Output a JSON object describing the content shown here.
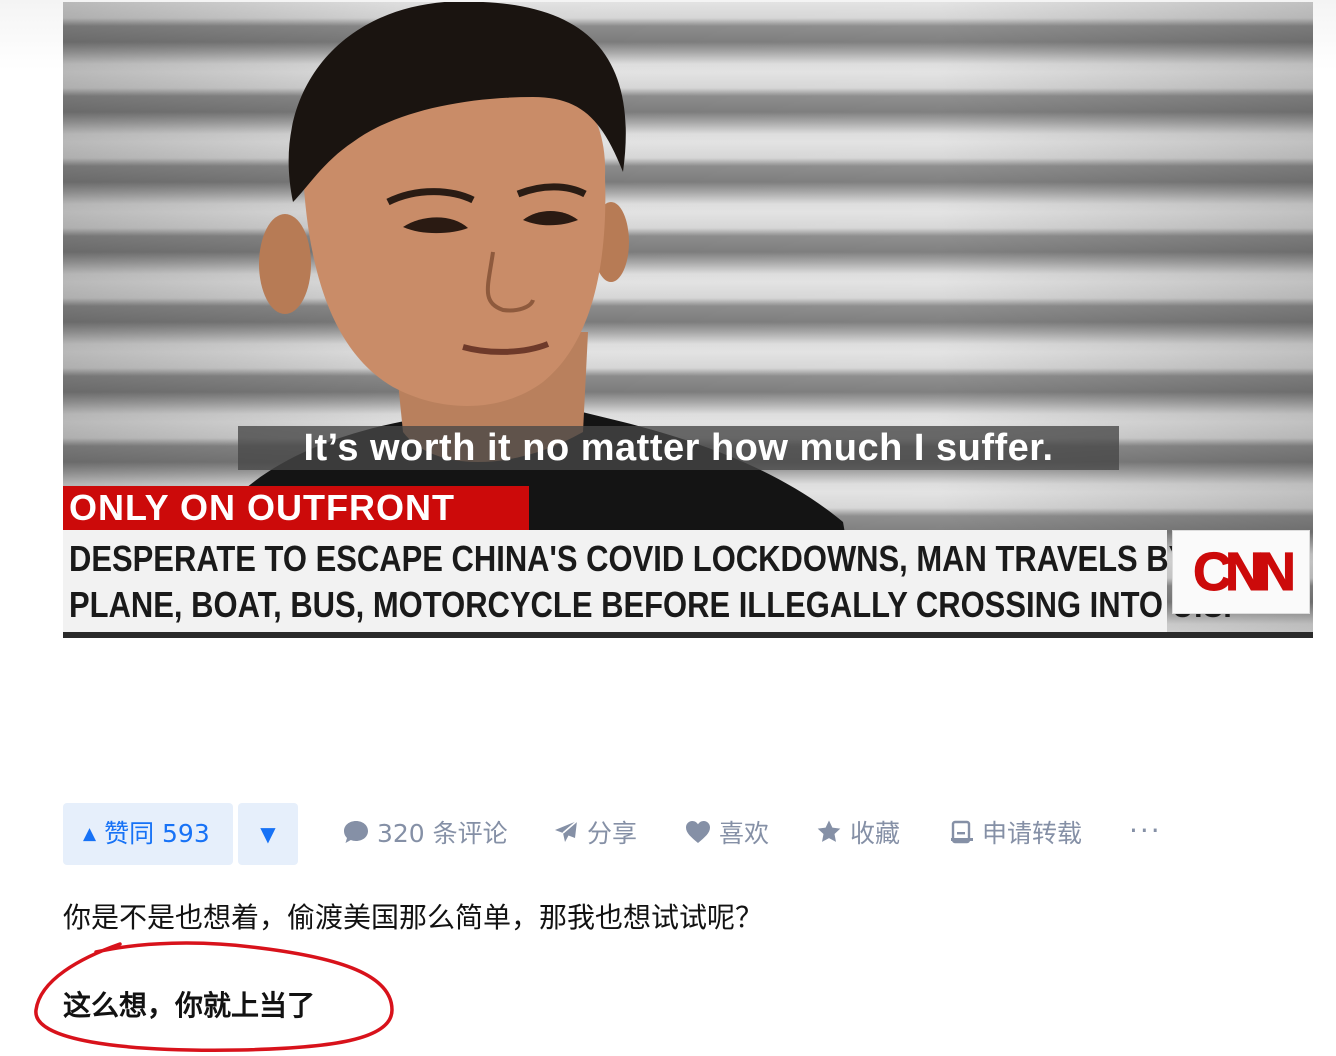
{
  "image": {
    "subtitle": "It’s worth it no matter how much I suffer.",
    "tag": "ONLY ON OUTFRONT",
    "headline_lines": [
      "DESPERATE TO ESCAPE CHINA'S COVID LOCKDOWNS, MAN TRAVELS BY",
      "PLANE, BOAT, BUS, MOTORCYCLE BEFORE ILLEGALLY CROSSING INTO U.S."
    ],
    "logo": "CNN"
  },
  "actions": {
    "upvote_label": "赞同 593",
    "downvote_icon": "caret-down-icon",
    "comments_label": "320 条评论",
    "share_label": "分享",
    "like_label": "喜欢",
    "collect_label": "收藏",
    "reprint_label": "申请转载",
    "more_label": "···"
  },
  "content": {
    "paragraph": "你是不是也想着，偷渡美国那么简单，那我也想试试呢？",
    "bold_line": "这么想，你就上当了"
  },
  "colors": {
    "accent_blue": "#1772f6",
    "vote_bg": "#e6effb",
    "action_gray": "#8590a6",
    "cnn_red": "#cc0a0a",
    "annotation_red": "#d8121b"
  }
}
